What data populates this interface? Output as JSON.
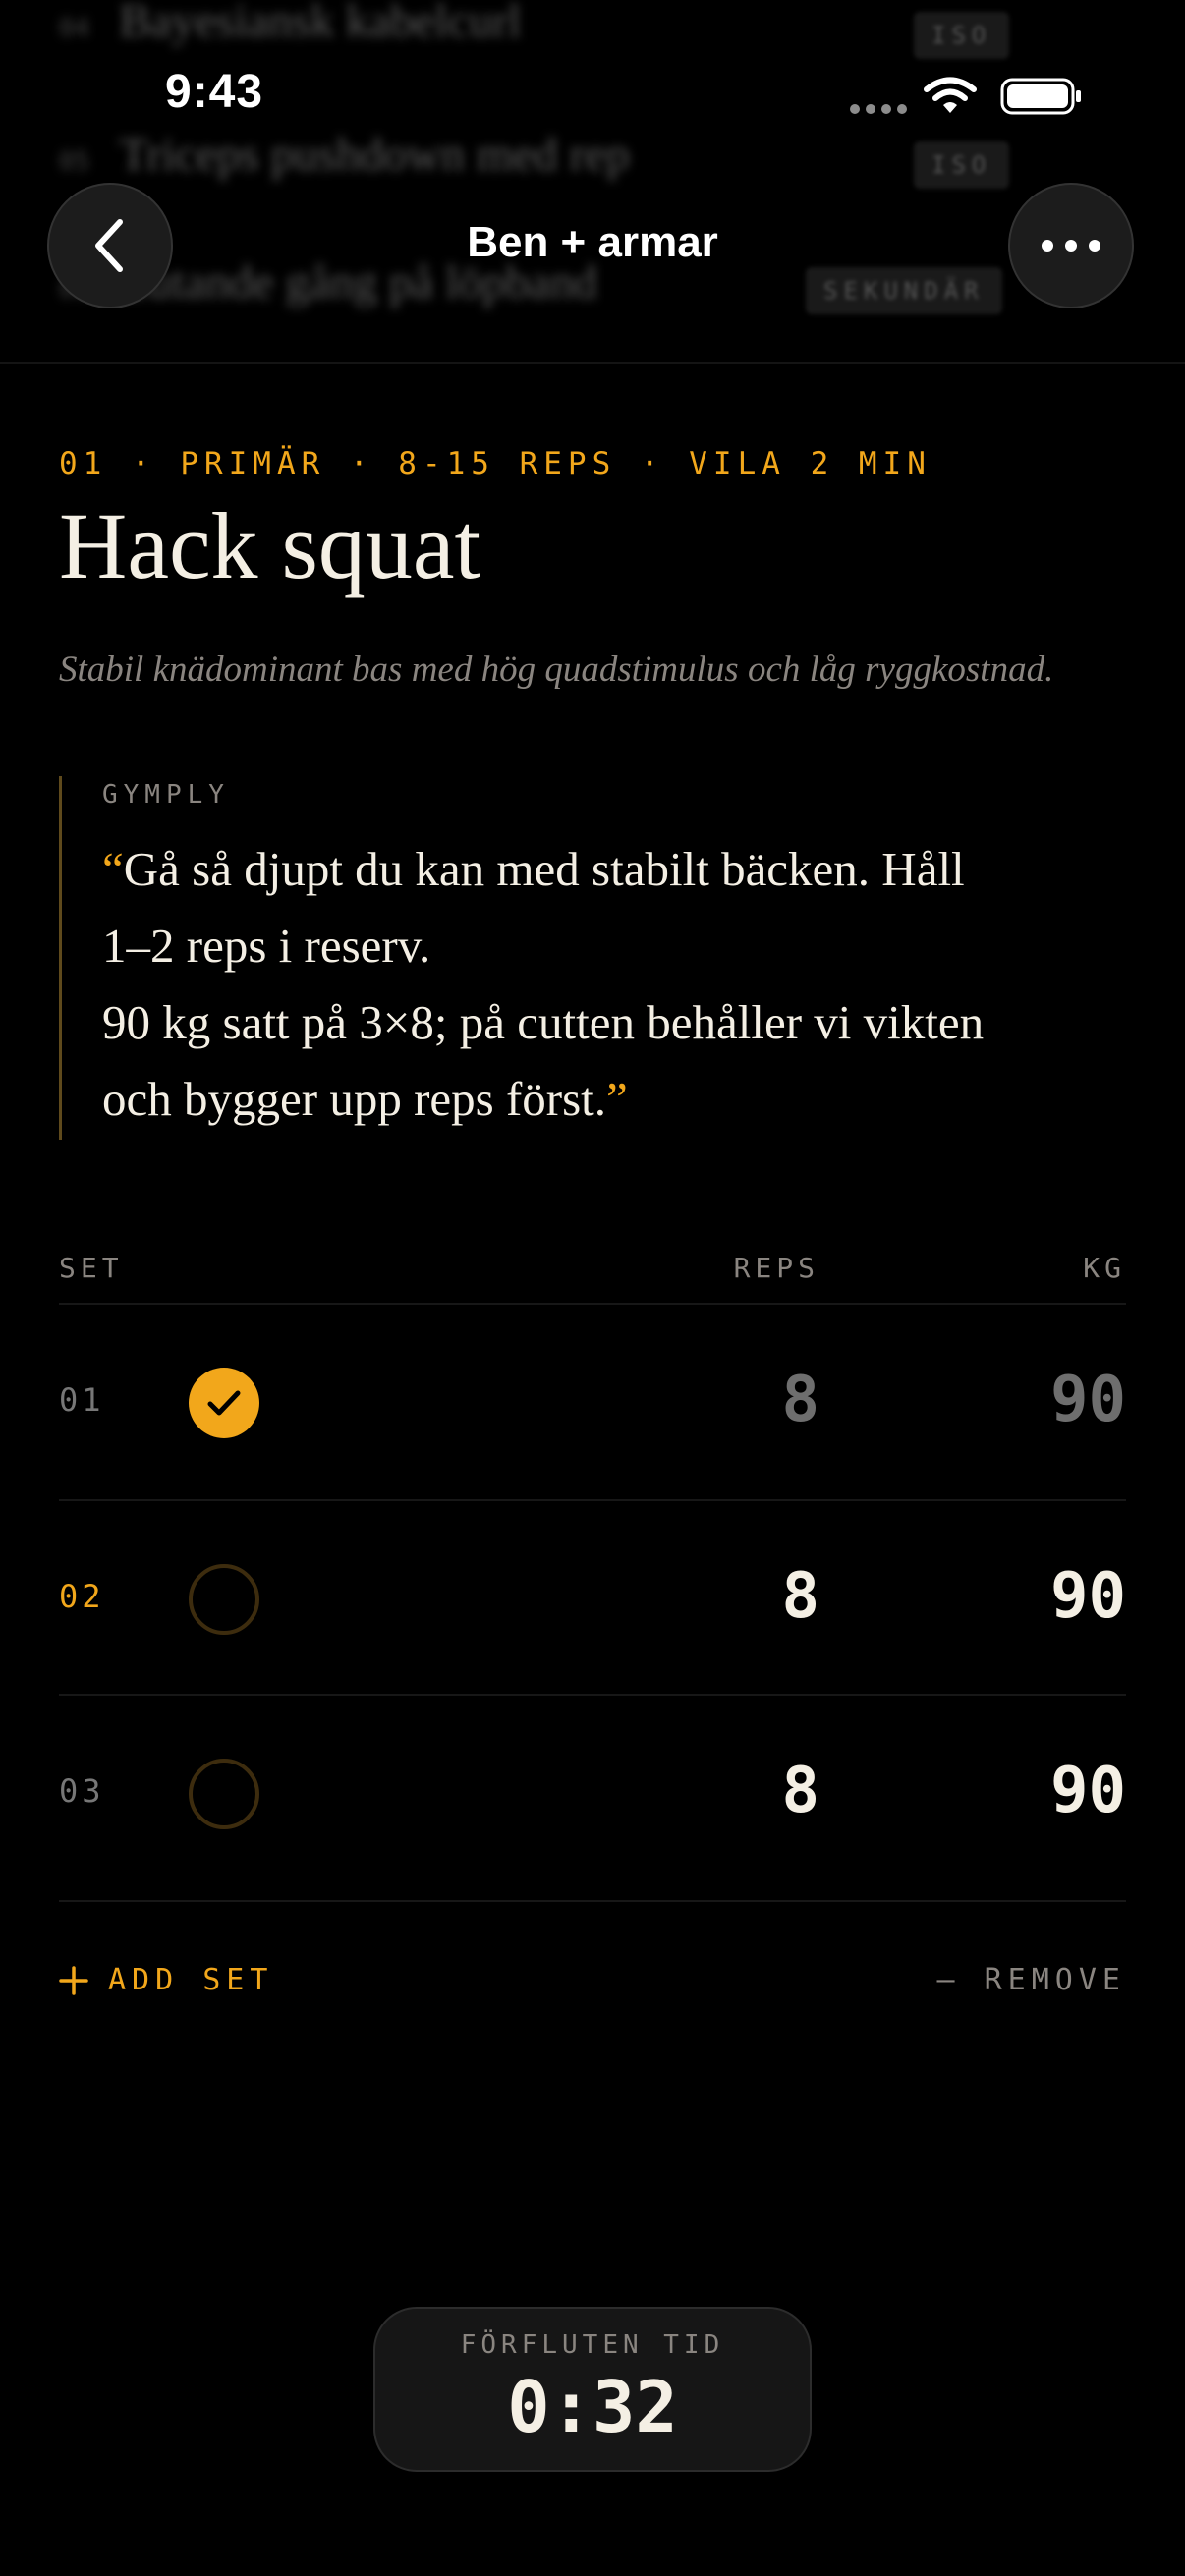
{
  "status_bar": {
    "time": "9:43"
  },
  "background_list": [
    {
      "num": "04",
      "name": "Bayesiansk kabelcurl",
      "tag": "ISO"
    },
    {
      "num": "05",
      "name": "Triceps pushdown med rep",
      "tag": "ISO"
    },
    {
      "num": "06",
      "name": "Lutande gång på löpband",
      "tag": "SEKUNDÄR"
    }
  ],
  "nav": {
    "title": "Ben + armar",
    "back_icon": "chevron-left-icon",
    "more_icon": "ellipsis-icon"
  },
  "exercise": {
    "meta": "01 · PRIMÄR · 8-15 REPS · VILA 2 MIN",
    "title": "Hack squat",
    "description": "Stabil knädominant bas med hög quadstimulus och låg ryggkostnad."
  },
  "coach_note": {
    "source": "GYMPLY",
    "open_quote": "“",
    "close_quote": "”",
    "lines": [
      "Gå så djupt du kan med stabilt bäcken. Håll",
      "1–2 reps i reserv.",
      "90 kg satt på 3×8; på cutten behåller vi vikten",
      "och bygger upp reps först."
    ]
  },
  "table": {
    "headers": {
      "set": "SET",
      "reps": "REPS",
      "kg": "KG"
    },
    "rows": [
      {
        "set": "01",
        "reps": "8",
        "kg": "90",
        "done": true
      },
      {
        "set": "02",
        "reps": "8",
        "kg": "90",
        "done": false
      },
      {
        "set": "03",
        "reps": "8",
        "kg": "90",
        "done": false
      }
    ]
  },
  "actions": {
    "add_set": "ADD SET",
    "remove": "— REMOVE"
  },
  "timer": {
    "label": "FÖRFLUTEN TID",
    "value": "0:32"
  },
  "colors": {
    "accent": "#f2a71b",
    "background": "#000000",
    "text": "#f4efe4"
  }
}
